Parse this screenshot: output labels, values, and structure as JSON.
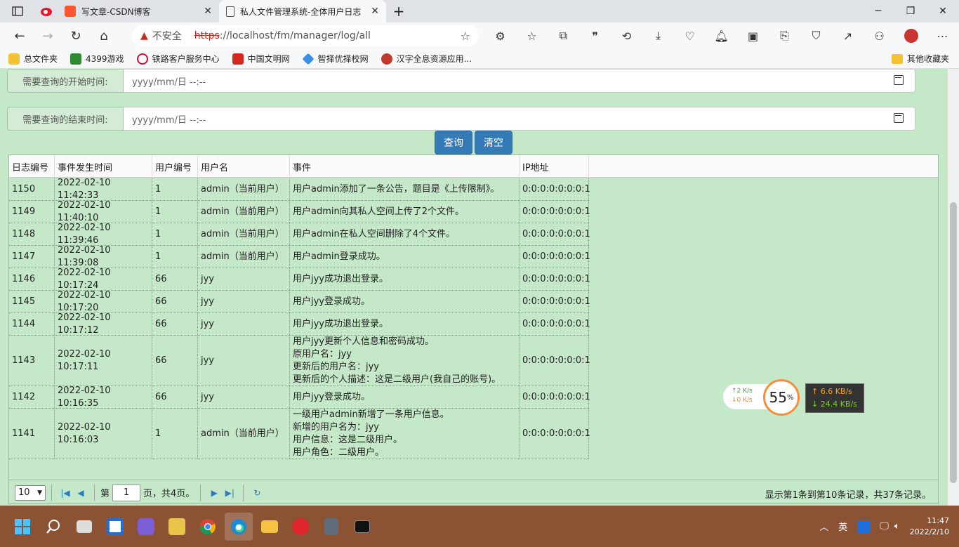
{
  "tabs": [
    {
      "title": "写文章-CSDN博客"
    },
    {
      "title": "私人文件管理系统-全体用户日志"
    }
  ],
  "address": {
    "security": "不安全",
    "scheme": "https",
    "rest": "://localhost/fm/manager/log/all"
  },
  "bookmarks": [
    "总文件夹",
    "4399游戏",
    "铁路客户服务中心",
    "中国文明网",
    "智择优择校网",
    "汉字全息资源应用..."
  ],
  "bookmarks_other": "其他收藏夹",
  "filters": {
    "start_label": "需要查询的开始时间:",
    "end_label": "需要查询的结束时间:",
    "date_placeholder": "yyyy/mm/日  --:--"
  },
  "buttons": {
    "query": "查询",
    "clear": "清空"
  },
  "table": {
    "headers": [
      "日志编号",
      "事件发生时间",
      "用户编号",
      "用户名",
      "事件",
      "IP地址"
    ],
    "rows": [
      {
        "id": "1150",
        "time": "2022-02-10 11:42:33",
        "uid": "1",
        "name": "admin（当前用户）",
        "event": [
          "用户admin添加了一条公告，题目是《上传限制》。"
        ],
        "ip": "0:0:0:0:0:0:0:1"
      },
      {
        "id": "1149",
        "time": "2022-02-10 11:40:10",
        "uid": "1",
        "name": "admin（当前用户）",
        "event": [
          "用户admin向其私人空间上传了2个文件。"
        ],
        "ip": "0:0:0:0:0:0:0:1"
      },
      {
        "id": "1148",
        "time": "2022-02-10 11:39:46",
        "uid": "1",
        "name": "admin（当前用户）",
        "event": [
          "用户admin在私人空间删除了4个文件。"
        ],
        "ip": "0:0:0:0:0:0:0:1"
      },
      {
        "id": "1147",
        "time": "2022-02-10 11:39:08",
        "uid": "1",
        "name": "admin（当前用户）",
        "event": [
          "用户admin登录成功。"
        ],
        "ip": "0:0:0:0:0:0:0:1"
      },
      {
        "id": "1146",
        "time": "2022-02-10 10:17:24",
        "uid": "66",
        "name": "jyy",
        "event": [
          "用户jyy成功退出登录。"
        ],
        "ip": "0:0:0:0:0:0:0:1"
      },
      {
        "id": "1145",
        "time": "2022-02-10 10:17:20",
        "uid": "66",
        "name": "jyy",
        "event": [
          "用户jyy登录成功。"
        ],
        "ip": "0:0:0:0:0:0:0:1"
      },
      {
        "id": "1144",
        "time": "2022-02-10 10:17:12",
        "uid": "66",
        "name": "jyy",
        "event": [
          "用户jyy成功退出登录。"
        ],
        "ip": "0:0:0:0:0:0:0:1"
      },
      {
        "id": "1143",
        "time": "2022-02-10 10:17:11",
        "uid": "66",
        "name": "jyy",
        "event": [
          "用户jyy更新个人信息和密码成功。",
          "原用户名：jyy",
          "更新后的用户名：jyy",
          "更新后的个人描述：这是二级用户(我自己的账号)。"
        ],
        "ip": "0:0:0:0:0:0:0:1"
      },
      {
        "id": "1142",
        "time": "2022-02-10 10:16:35",
        "uid": "66",
        "name": "jyy",
        "event": [
          "用户jyy登录成功。"
        ],
        "ip": "0:0:0:0:0:0:0:1"
      },
      {
        "id": "1141",
        "time": "2022-02-10 10:16:03",
        "uid": "1",
        "name": "admin（当前用户）",
        "event": [
          "一级用户admin新增了一条用户信息。",
          "新增的用户名为：jyy",
          "用户信息：这是二级用户。",
          "用户角色：二级用户。"
        ],
        "ip": "0:0:0:0:0:0:0:1"
      }
    ]
  },
  "pager": {
    "page_size": "10",
    "prefix": "第",
    "page": "1",
    "suffix": "页，共4页。",
    "info": "显示第1条到第10条记录，共37条记录。"
  },
  "speed": {
    "up_small": "↑2  K/s",
    "down_small": "↓0  K/s",
    "percent": "55",
    "percent_unit": "%",
    "up": "↑ 6.6 KB/s",
    "down": "↓ 24.4 KB/s"
  },
  "tray": {
    "ime": "英",
    "time": "11:47",
    "date": "2022/2/10"
  },
  "colors": {
    "accent": "#337ab7",
    "page_bg": "#c5e8c8",
    "taskbar": "#8b5333"
  }
}
